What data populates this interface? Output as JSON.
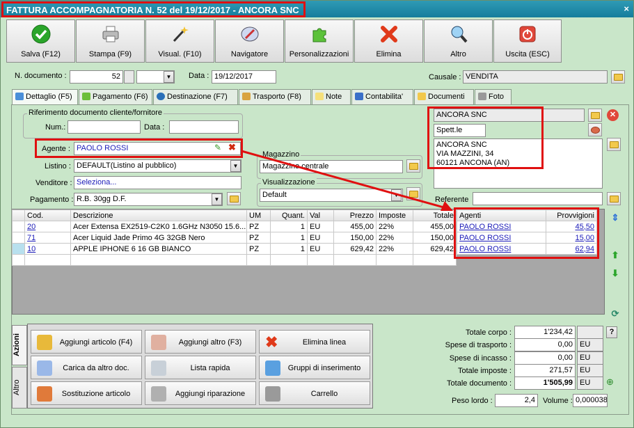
{
  "window": {
    "title": "FATTURA ACCOMPAGNATORIA N. 52 del 19/12/2017 - ANCORA SNC",
    "close_symbol": "×"
  },
  "toolbar": {
    "buttons": [
      {
        "label": "Salva (F12)",
        "icon": "check-icon"
      },
      {
        "label": "Stampa (F9)",
        "icon": "printer-icon"
      },
      {
        "label": "Visual. (F10)",
        "icon": "magic-wand-icon"
      },
      {
        "label": "Navigatore",
        "icon": "compass-icon"
      },
      {
        "label": "Personalizzazioni",
        "icon": "puzzle-icon"
      },
      {
        "label": "Elimina",
        "icon": "delete-x-icon"
      },
      {
        "label": "Altro",
        "icon": "magnifier-icon"
      },
      {
        "label": "Uscita (ESC)",
        "icon": "power-icon"
      }
    ]
  },
  "doc": {
    "number_label": "N. documento :",
    "number": "52",
    "date_label": "Data :",
    "date": "19/12/2017",
    "causale_label": "Causale :",
    "causale": "VENDITA"
  },
  "tabs": [
    "Dettaglio (F5)",
    "Pagamento (F6)",
    "Destinazione (F7)",
    "Trasporto (F8)",
    "Note",
    "Contabilita'",
    "Documenti",
    "Foto"
  ],
  "riferimento": {
    "title": "Riferimento documento cliente/fornitore",
    "num_label": "Num.:",
    "data_label": "Data :"
  },
  "agente": {
    "label": "Agente :",
    "value": "PAOLO ROSSI"
  },
  "listino": {
    "label": "Listino :",
    "value": "DEFAULT(Listino al pubblico)"
  },
  "venditore": {
    "label": "Venditore :",
    "value": "Seleziona..."
  },
  "pagamento": {
    "label": "Pagamento :",
    "value": "R.B. 30gg D.F."
  },
  "magazzino": {
    "title": "Magazzino",
    "value": "Magazzino centrale"
  },
  "visualizzazione": {
    "title": "Visualizzazione",
    "value": "Default"
  },
  "cliente": {
    "name": "ANCORA SNC",
    "salutation": "Spett.le",
    "address_lines": [
      "ANCORA SNC",
      "VIA MAZZINI, 34",
      "60121 ANCONA (AN)"
    ],
    "referente_label": "Referente"
  },
  "grid": {
    "headers": [
      "Cod.",
      "Descrizione",
      "UM",
      "Quant.",
      "Val",
      "Prezzo",
      "Imposte",
      "Totale"
    ],
    "rows": [
      [
        "20",
        "Acer Extensa EX2519-C2K0 1.6GHz N3050 15.6...",
        "PZ",
        "1",
        "EU",
        "455,00",
        "22%",
        "455,00"
      ],
      [
        "71",
        "Acer Liquid Jade Primo 4G 32GB Nero",
        "PZ",
        "1",
        "EU",
        "150,00",
        "22%",
        "150,00"
      ],
      [
        "10",
        "APPLE IPHONE 6 16 GB BIANCO",
        "PZ",
        "1",
        "EU",
        "629,42",
        "22%",
        "629,42"
      ]
    ]
  },
  "agenti_grid": {
    "headers": [
      "Agenti",
      "Provvigioni"
    ],
    "rows": [
      [
        "PAOLO ROSSI",
        "45,50"
      ],
      [
        "PAOLO ROSSI",
        "15,00"
      ],
      [
        "PAOLO ROSSI",
        "62,94"
      ]
    ]
  },
  "actions": {
    "vtabs": [
      "Azioni",
      "Altro"
    ],
    "buttons": [
      "Aggiungi articolo (F4)",
      "Aggiungi altro (F3)",
      "Elimina linea",
      "Carica da altro doc.",
      "Lista rapida",
      "Gruppi di inserimento",
      "Sostituzione articolo",
      "Aggiungi riparazione",
      "Carrello"
    ]
  },
  "totals": {
    "totale_corpo_label": "Totale corpo :",
    "totale_corpo": "1'234,42",
    "spese_trasporto_label": "Spese di trasporto :",
    "spese_trasporto": "0,00",
    "spese_incasso_label": "Spese di incasso :",
    "spese_incasso": "0,00",
    "totale_imposte_label": "Totale imposte :",
    "totale_imposte": "271,57",
    "totale_documento_label": "Totale documento :",
    "totale_documento": "1'505,99",
    "currency": "EU",
    "peso_lordo_label": "Peso lordo :",
    "peso_lordo": "2,4",
    "volume_label": "Volume :",
    "volume": "0,000038",
    "help": "?"
  }
}
